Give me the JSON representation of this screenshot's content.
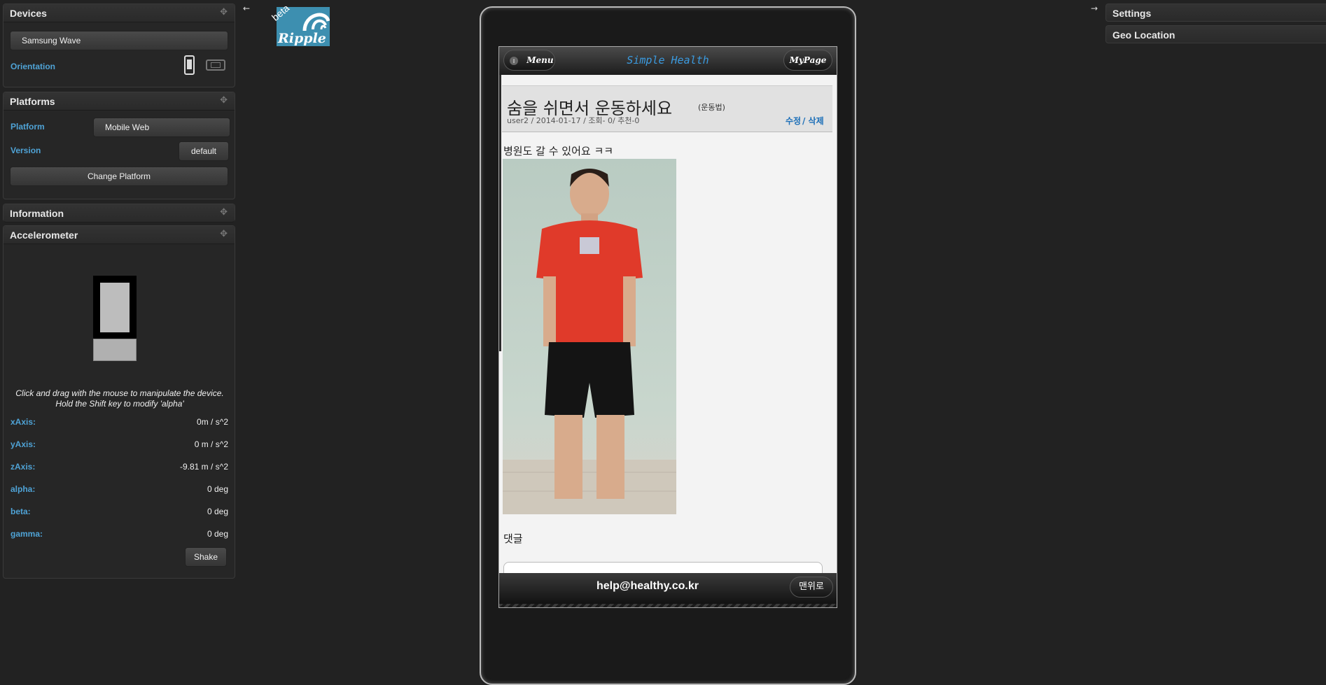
{
  "left_panel": {
    "devices": {
      "title": "Devices",
      "device_select": "Samsung Wave",
      "orientation_label": "Orientation"
    },
    "platforms": {
      "title": "Platforms",
      "platform_label": "Platform",
      "platform_value": "Mobile Web",
      "version_label": "Version",
      "version_value": "default",
      "change_button": "Change Platform"
    },
    "information": {
      "title": "Information"
    },
    "accelerometer": {
      "title": "Accelerometer",
      "instructions_line1": "Click and drag with the mouse to manipulate the device.",
      "instructions_line2": "Hold the Shift key to modify 'alpha'",
      "readings": [
        {
          "label": "xAxis:",
          "value": "0m / s^2"
        },
        {
          "label": "yAxis:",
          "value": "0 m / s^2"
        },
        {
          "label": "zAxis:",
          "value": "-9.81 m / s^2"
        },
        {
          "label": "alpha:",
          "value": "0 deg"
        },
        {
          "label": "beta:",
          "value": "0 deg"
        },
        {
          "label": "gamma:",
          "value": "0 deg"
        }
      ],
      "shake_button": "Shake"
    }
  },
  "logo": {
    "badge": "beta",
    "text": "Ripple"
  },
  "right_panel": {
    "settings_title": "Settings",
    "geo_title": "Geo Location"
  },
  "app": {
    "menu_button": "Menu",
    "title": "Simple Health",
    "mypage_button": "MyPage",
    "post": {
      "title": "숨을 쉬면서 운동하세요",
      "category": "(운동법)",
      "meta": "user2 / 2014-01-17 / 조회- 0/ 추천-0",
      "edit_link": "수정",
      "delete_link": "/ 삭제",
      "body": "병원도 갈 수 있어요 ㅋㅋ",
      "comments_heading": "댓글"
    },
    "footer_email": "help@healthy.co.kr",
    "top_button": "맨위로"
  },
  "colors": {
    "background": "#222222",
    "accent_label": "#4fa3d6",
    "app_title": "#3b9be0",
    "link": "#1c6fb8"
  }
}
